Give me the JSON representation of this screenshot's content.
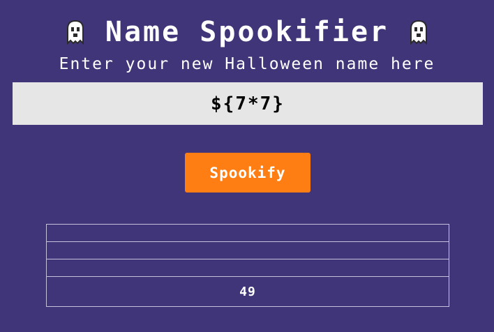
{
  "header": {
    "title": "Name Spookifier",
    "left_icon": "ghost-icon",
    "right_icon": "ghost-icon"
  },
  "subtitle": "Enter your new Halloween name here",
  "form": {
    "input_value": "${7*7}",
    "button_label": "Spookify"
  },
  "results": {
    "rows": [
      "",
      "",
      "",
      "49"
    ]
  },
  "colors": {
    "background": "#403578",
    "input_background": "#e6e6e6",
    "button_background": "#fe7e14",
    "text": "#ffffff",
    "table_border": "#c7c2dc"
  }
}
